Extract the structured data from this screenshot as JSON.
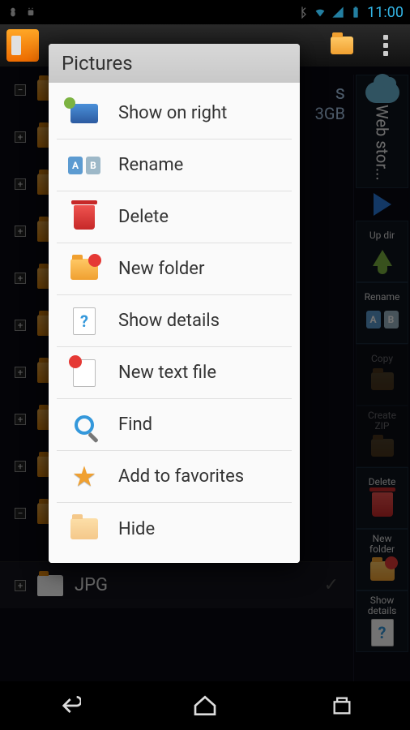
{
  "status": {
    "time": "11:00"
  },
  "popup": {
    "title": "Pictures",
    "items": [
      {
        "label": "Show on right"
      },
      {
        "label": "Rename"
      },
      {
        "label": "Delete"
      },
      {
        "label": "New folder"
      },
      {
        "label": "Show details"
      },
      {
        "label": "New text file"
      },
      {
        "label": "Find"
      },
      {
        "label": "Add to favorites"
      },
      {
        "label": "Hide"
      }
    ]
  },
  "storage": {
    "size": "3GB",
    "suffix": "s"
  },
  "tree": {
    "jpg": "JPG"
  },
  "toolbar": {
    "web": "Web stor...",
    "updir": "Up dir",
    "rename": "Rename",
    "copy": "Copy",
    "createzip": "Create\nZIP",
    "delete": "Delete",
    "newfolder": "New\nfolder",
    "showdetails": "Show\ndetails"
  }
}
